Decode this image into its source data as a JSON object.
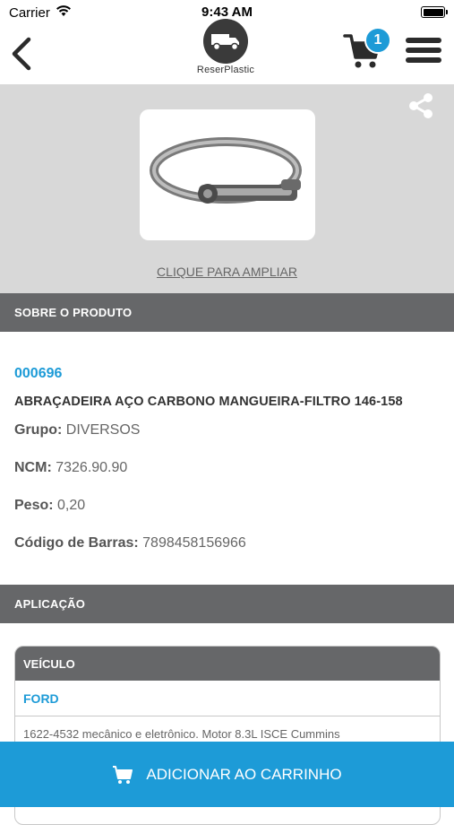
{
  "status_bar": {
    "carrier": "Carrier",
    "time": "9:43 AM"
  },
  "nav": {
    "logo_text": "ReserPlastic",
    "cart_count": "1"
  },
  "image_area": {
    "zoom_label": "CLIQUE PARA AMPLIAR"
  },
  "about": {
    "header": "SOBRE O PRODUTO",
    "code": "000696",
    "name": "ABRAÇADEIRA AÇO CARBONO MANGUEIRA-FILTRO 146-158",
    "specs": [
      {
        "label": "Grupo:",
        "value": "DIVERSOS"
      },
      {
        "label": "NCM:",
        "value": "7326.90.90"
      },
      {
        "label": "Peso:",
        "value": "0,20"
      },
      {
        "label": "Código de Barras:",
        "value": "7898458156966"
      }
    ]
  },
  "application": {
    "header": "APLICAÇÃO",
    "table_header": "VEÍCULO",
    "make": "FORD",
    "model": "1622-4532 mecânico e eletrônico. Motor 8.3L ISCE Cummins"
  },
  "add_to_cart": {
    "label": "ADICIONAR AO CARRINHO"
  },
  "colors": {
    "accent": "#1d9bd7",
    "section_bg": "#666769",
    "image_bg": "#d8d8d8"
  }
}
